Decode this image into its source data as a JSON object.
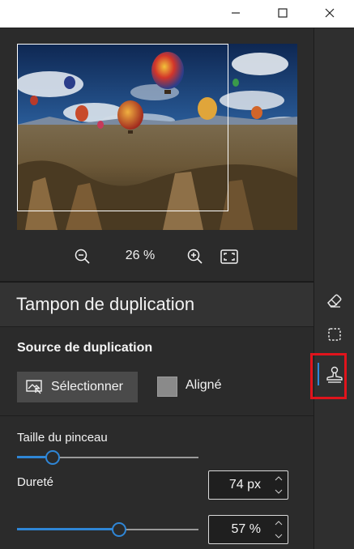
{
  "window": {
    "minimize_icon": "minimize-icon",
    "maximize_icon": "maximize-icon",
    "close_icon": "close-icon"
  },
  "preview": {
    "image_content": "hot-air-balloons-over-rocky-valley",
    "zoom_value": "26 %",
    "zoom_out_icon": "zoom-out-icon",
    "zoom_in_icon": "zoom-in-icon",
    "fit_icon": "fit-to-screen-icon"
  },
  "clone_panel": {
    "title": "Tampon de duplication",
    "source_label": "Source de duplication",
    "select_button_label": "Sélectionner",
    "aligned_label": "Aligné",
    "aligned_checked": false,
    "brush_size_label": "Taille du pinceau",
    "brush_size_value": "74 px",
    "brush_size_fraction": 0.17,
    "hardness_label": "Dureté",
    "hardness_value": "57 %",
    "hardness_fraction": 0.57
  },
  "tools": {
    "items": [
      "eraser-icon",
      "selection-icon",
      "clone-stamp-icon"
    ],
    "active": "clone-stamp-icon"
  },
  "colors": {
    "accent": "#2f86d6",
    "panel_bg": "#2b2b2b",
    "highlight": "#e0141c"
  }
}
